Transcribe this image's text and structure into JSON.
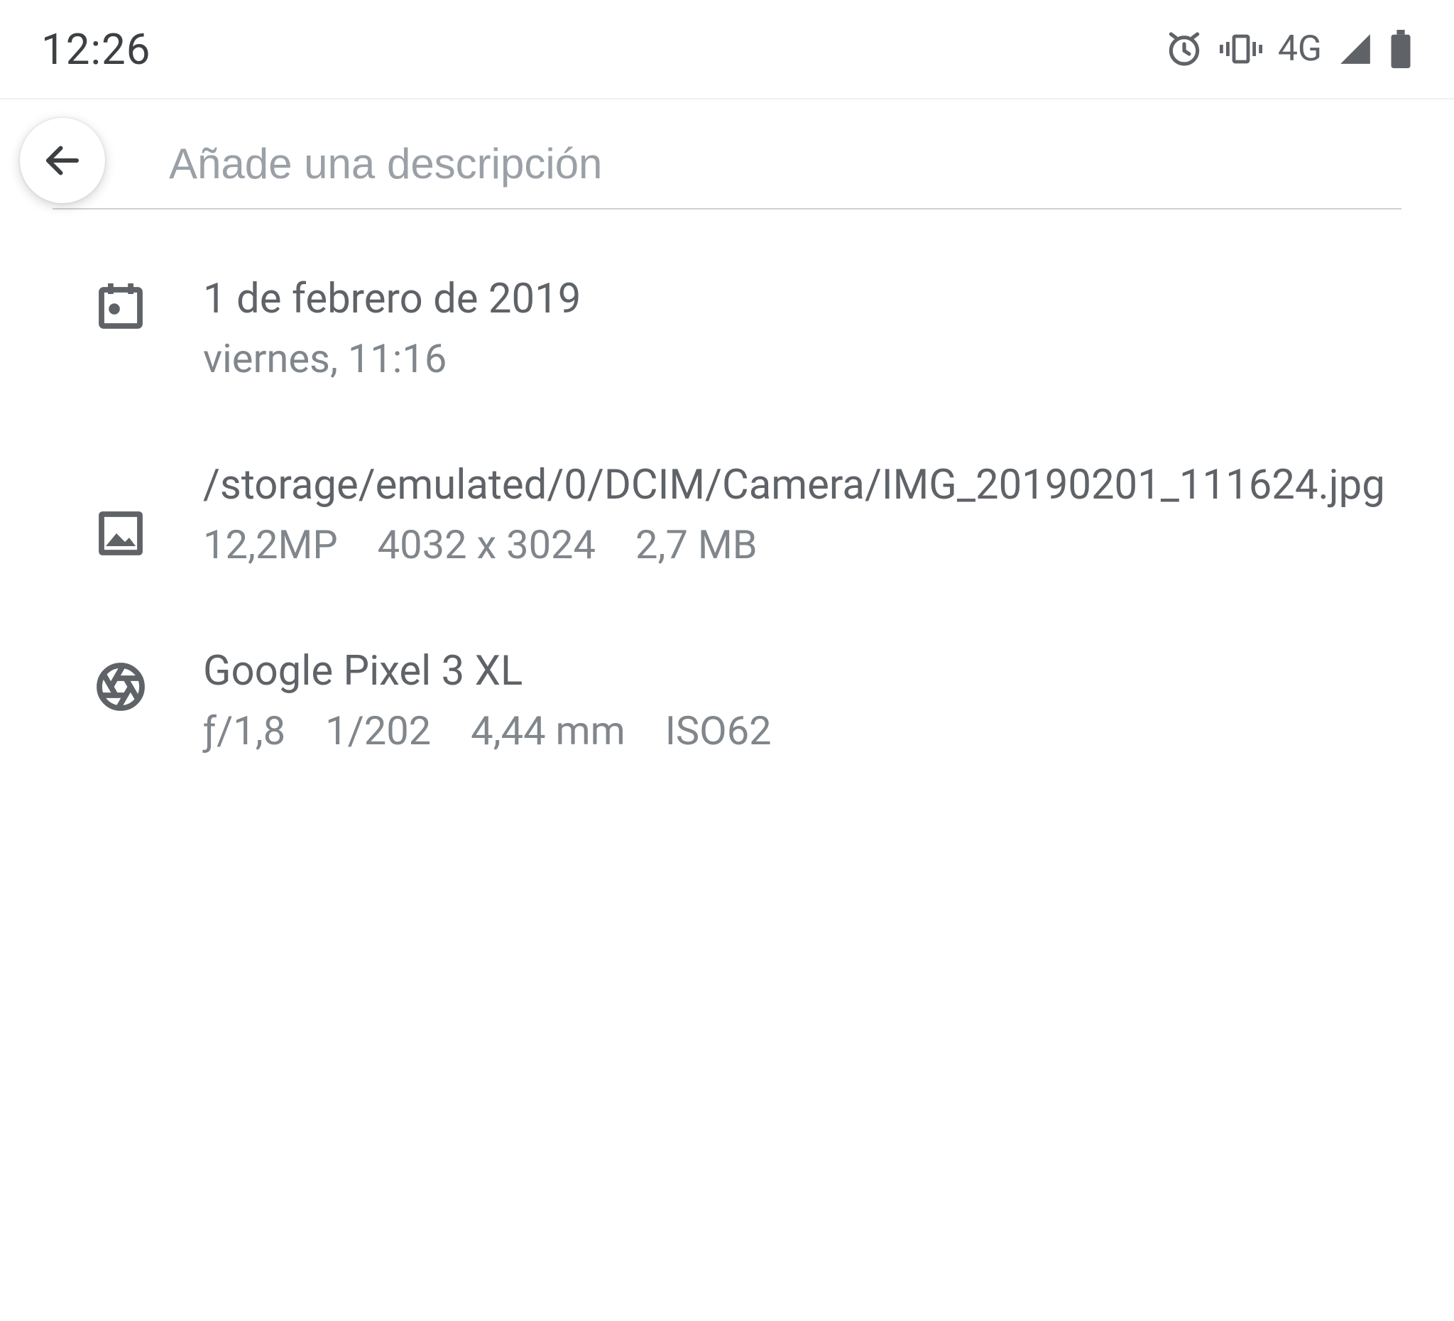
{
  "status": {
    "time": "12:26",
    "network_label": "4G"
  },
  "header": {
    "description_placeholder": "Añade una descripción"
  },
  "date": {
    "title": "1 de febrero de 2019",
    "subtitle": "viernes, 11:16"
  },
  "file": {
    "path": "/storage/emulated/0/DCIM/Camera/IMG_20190201_111624.jpg",
    "mp": "12,2MP",
    "resolution": "4032 x 3024",
    "size": "2,7 MB"
  },
  "camera": {
    "name": "Google Pixel 3 XL",
    "aperture": "ƒ/1,8",
    "shutter": "1/202",
    "focal": "4,44 mm",
    "iso": "ISO62"
  }
}
